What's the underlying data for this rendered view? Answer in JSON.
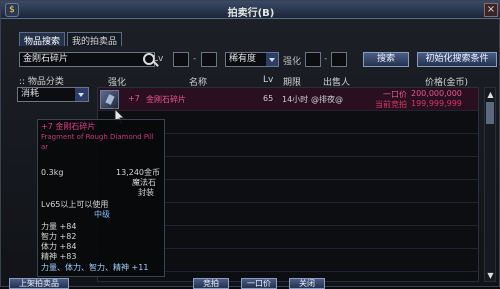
{
  "window": {
    "title": "拍卖行(B)",
    "close_label": "×",
    "title_icon": "$"
  },
  "tabs": [
    {
      "label": "物品搜索"
    },
    {
      "label": "我的拍卖品"
    }
  ],
  "search": {
    "value": "金刚石碎片",
    "level_label": "Lv",
    "level_sep": "-",
    "rarity_value": "稀有度",
    "enhance_label": "强化",
    "enhance_sep": "-",
    "search_button": "搜索",
    "reset_button": "初始化搜索条件"
  },
  "category": {
    "label": ":: 物品分类",
    "value": "消耗"
  },
  "table": {
    "headers": {
      "enhance": "强化",
      "name": "名称",
      "level": "Lv",
      "period": "期限",
      "seller": "出售人",
      "price": "价格(金币)"
    },
    "rows": [
      {
        "enhance": "+7",
        "name": "金刚石碎片",
        "level": "65",
        "period": "14小时",
        "seller": "@排夜@",
        "buyout_label": "一口价",
        "buyout": "200,000,000",
        "bid_label": "当前竞拍",
        "bid": "199,999,999"
      }
    ]
  },
  "tooltip": {
    "name": "+7 金刚石碎片",
    "name_en": "Fragment of Rough Diamond Pill ar",
    "weight": "0.3kg",
    "price": "13,240金币",
    "type": "魔法石",
    "sealed": "封装",
    "requirement": "Lv65以上可以使用",
    "grade": "中级",
    "stats": [
      "力量 +84",
      "智力 +82",
      "体力 +84",
      "精神 +83"
    ],
    "all_stats": "力量、体力、智力、精神 +11"
  },
  "bottom": {
    "left": "上架拍卖品",
    "b1": "竞拍",
    "b2": "一口价",
    "b3": "关闭"
  },
  "scroll": {
    "up": "▲",
    "down": "▼"
  }
}
